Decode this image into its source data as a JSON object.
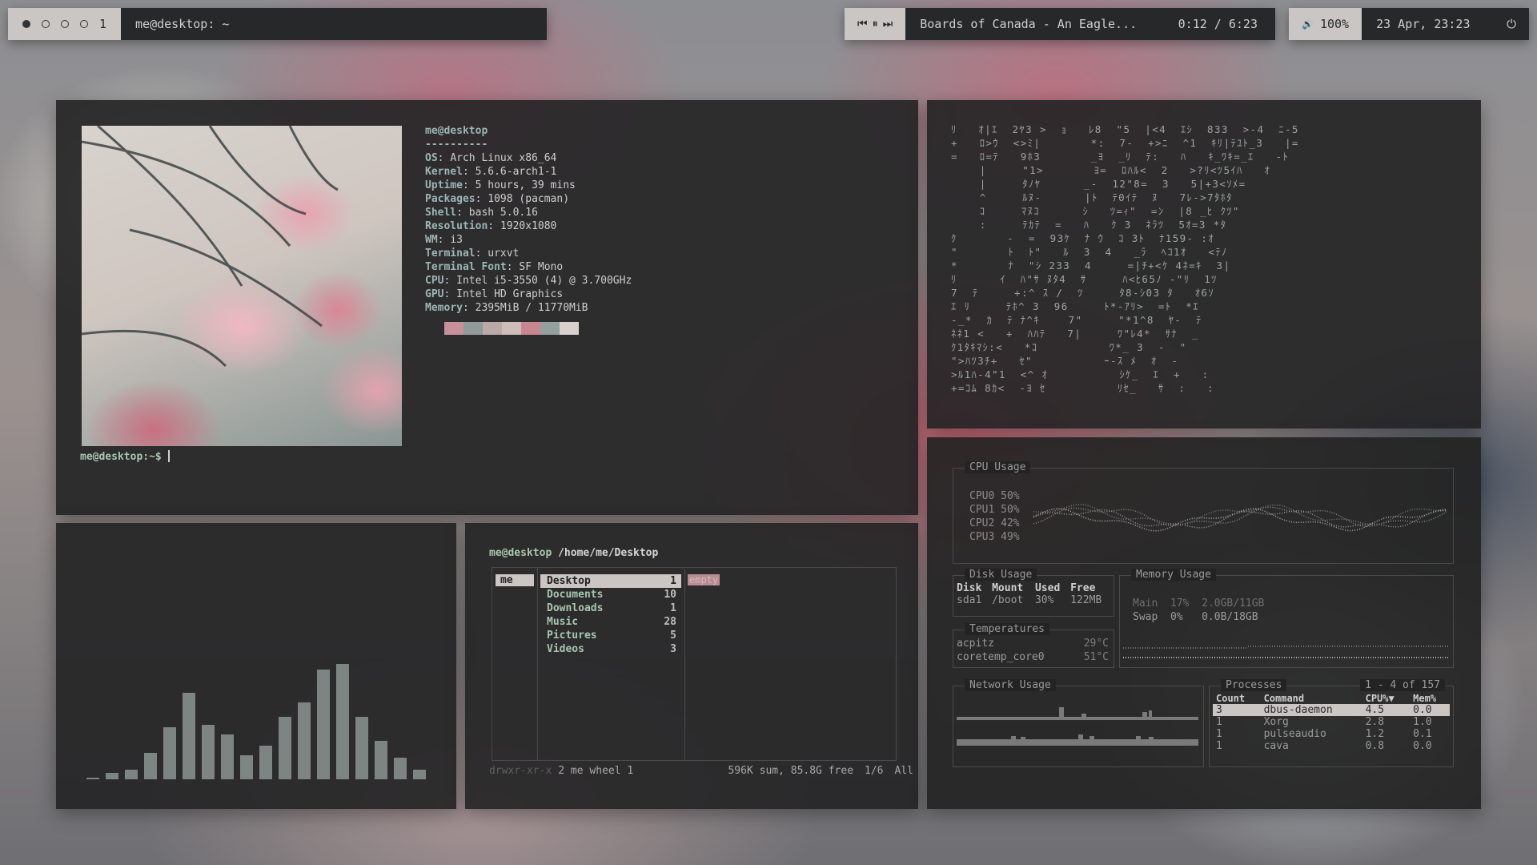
{
  "topbar": {
    "workspaces": [
      {
        "icon": "filled-circle-icon",
        "active": true
      },
      {
        "icon": "empty-circle-icon",
        "active": false
      },
      {
        "icon": "empty-circle-icon",
        "active": false
      },
      {
        "icon": "empty-circle-icon",
        "active": false
      }
    ],
    "workspace_number": "1",
    "window_title": "me@desktop: ~",
    "media": {
      "prev": "⏮",
      "pause": "⏸",
      "next": "⏭",
      "track": "Boards of Canada - An Eagle...",
      "time": "0:12 / 6:23"
    },
    "volume": {
      "icon": "🔊",
      "label": "100%"
    },
    "datetime": "23 Apr, 23:23",
    "power_icon": "⏻"
  },
  "neofetch": {
    "header": "me@desktop",
    "separator": "----------",
    "fields": [
      {
        "k": "OS",
        "v": "Arch Linux x86_64"
      },
      {
        "k": "Kernel",
        "v": "5.6.6-arch1-1"
      },
      {
        "k": "Uptime",
        "v": "5 hours, 39 mins"
      },
      {
        "k": "Packages",
        "v": "1098 (pacman)"
      },
      {
        "k": "Shell",
        "v": "bash 5.0.16"
      },
      {
        "k": "Resolution",
        "v": "1920x1080"
      },
      {
        "k": "WM",
        "v": "i3"
      },
      {
        "k": "Terminal",
        "v": "urxvt"
      },
      {
        "k": "Terminal Font",
        "v": "SF Mono"
      },
      {
        "k": "CPU",
        "v": "Intel i5-3550 (4) @ 3.700GHz"
      },
      {
        "k": "GPU",
        "v": "Intel HD Graphics"
      },
      {
        "k": "Memory",
        "v": "2395MiB / 11770MiB"
      }
    ],
    "palette": [
      "#c7909a",
      "#8f9a99",
      "#b9a9a7",
      "#cdbdb9",
      "#c88690",
      "#93a09d",
      "#d9d0ce"
    ],
    "prompt": "me@desktop:~$ "
  },
  "matrix": {
    "lines": [
      "ﾘ   ｵ|ｴ  2ﾔ3 >  ｮ   ﾚ8  \"5  |<4  ｴｼ  833  >-4  ﾆ-5",
      "+   ﾛ>ｳ  <>ﾐ|       *:  7-  +>ﾆ  ^1  ｷﾘ|ﾃﾕﾄ_3   |=",
      "=   ﾛ=ﾃ   9ﾎ3       _ﾖ  _ﾘ  ﾃ:   ﾊ   ｷ_ﾜｷ=_ｴ   -ﾄ",
      "    |     \"1>       ﾖ=  ﾛﾊﾙ<  2   >?ﾘ<ﾂ5ｲﾊ   ｵ",
      "    |     ﾀﾉﾔ      _-  12\"8=  3   5|+3<ｿﾒ=",
      "    ^     ﾙﾇ-      |ﾄ  ﾃ0ｲﾃ  ﾇ   7ﾚ->7ﾀﾎﾀ",
      "    ｺ     ﾏﾇｺ      ｼ   ﾂ=ｨ\"  =ﾝ  |8 _ﾋ ｸﾂ\"",
      "    :     ﾃｶﾃ  =   ﾊ   ｸ 3  ﾈﾗﾂ  5ｵ=3 *ﾀ",
      "ｸ       -  =  93ｹ  ﾅ ｳ  ｺ 3ﾄ  ﾅ159- :ｵ",
      "\"       ﾄ  ﾄ\"   ﾙ  3  4   _ﾗ  ﾍｺ1ｵ   <ﾃﾉ",
      "*       ﾅ  \"ｼ 233  4     =|ﾁ+<ｹ 4ﾈ=ｷ  3|",
      "ﾘ      ｲ  ﾊ\"ｻ ﾇﾀ4  ｻ     ﾊ<ﾋ65ﾉ -\"ﾘ  1ﾂ",
      "7  ﾃ     +:^ ｽ /  ﾂ     ﾀ8-ｼ03 ﾀ   ｵ6ｿ",
      "ｴ ﾘ     ﾃﾎ^ 3  96     ﾄ*-ｱﾘ>  =ﾄ  *ｴ",
      "-_*  ｶ  ﾃ ﾅ^ｷ    7\"     \"*1^8  ﾔ-  ﾃ",
      "ﾈﾈ1 <   +  ﾊﾊﾃ   7|     ﾜ\"ﾚ4*  ｻﾅ  _",
      "ｸ1ﾀｷﾏｼ:<   *ｺ          ﾜ*_ 3  -  \"",
      "\">ﾊﾂ3ﾁ+   ｾ\"          ｰ-ｽ ﾒ  ｵ  -",
      ">ﾙ1ﾊ-4\"1  <^ ｵ          ｼｹ_  ｴ  +   :",
      "+=ｺﾑ 8ｶ<  -ﾖ ｾ          ﾘｾ_   ｻ  :   :"
    ]
  },
  "visualizer": {
    "bars": [
      2,
      8,
      12,
      33,
      65,
      108,
      68,
      56,
      30,
      42,
      78,
      96,
      137,
      144,
      78,
      48,
      27,
      12
    ]
  },
  "ranger": {
    "path_user": "me@desktop",
    "path_dir": "/home/me/Desktop",
    "parent": "me",
    "entries": [
      {
        "name": "Desktop",
        "count": "1"
      },
      {
        "name": "Documents",
        "count": "10"
      },
      {
        "name": "Downloads",
        "count": "1"
      },
      {
        "name": "Music",
        "count": "28"
      },
      {
        "name": "Pictures",
        "count": "5"
      },
      {
        "name": "Videos",
        "count": "3"
      }
    ],
    "preview": "empty",
    "perms": "drwxr-xr-x",
    "owner": "2 me wheel 1",
    "summary": "596K sum, 85.8G free",
    "position": "1/6",
    "scope": "All"
  },
  "gotop": {
    "cpu": {
      "title": "CPU Usage",
      "cores": [
        {
          "label": "CPU0",
          "pct": "50%"
        },
        {
          "label": "CPU1",
          "pct": "50%"
        },
        {
          "label": "CPU2",
          "pct": "42%"
        },
        {
          "label": "CPU3",
          "pct": "49%"
        }
      ]
    },
    "disk": {
      "title": "Disk Usage",
      "headers": [
        "Disk",
        "Mount",
        "Used",
        "Free"
      ],
      "rows": [
        [
          "sda1",
          "/boot",
          "30%",
          "122MB"
        ]
      ]
    },
    "memory": {
      "title": "Memory Usage",
      "rows": [
        {
          "label": "Main",
          "pct": "17%",
          "val": "2.0GB/11GB"
        },
        {
          "label": "Swap",
          "pct": "0%",
          "val": "0.0B/18GB"
        }
      ]
    },
    "temps": {
      "title": "Temperatures",
      "rows": [
        {
          "name": "acpitz",
          "val": "29°C"
        },
        {
          "name": "coretemp_core0",
          "val": "51°C"
        }
      ]
    },
    "network": {
      "title": "Network Usage"
    },
    "processes": {
      "title": "Processes",
      "range": "1 - 4 of 157",
      "headers": [
        "Count",
        "Command",
        "CPU%▼",
        "Mem%"
      ],
      "rows": [
        [
          "3",
          "dbus-daemon",
          "4.5",
          "0.0"
        ],
        [
          "1",
          "Xorg",
          "2.8",
          "1.0"
        ],
        [
          "1",
          "pulseaudio",
          "1.2",
          "0.1"
        ],
        [
          "1",
          "cava",
          "0.8",
          "0.0"
        ]
      ]
    }
  },
  "colors": {
    "accent": "#9bb7b4",
    "prompt": "#a9c6b2",
    "selection": "#c9c6c3",
    "panel": "#222223"
  }
}
